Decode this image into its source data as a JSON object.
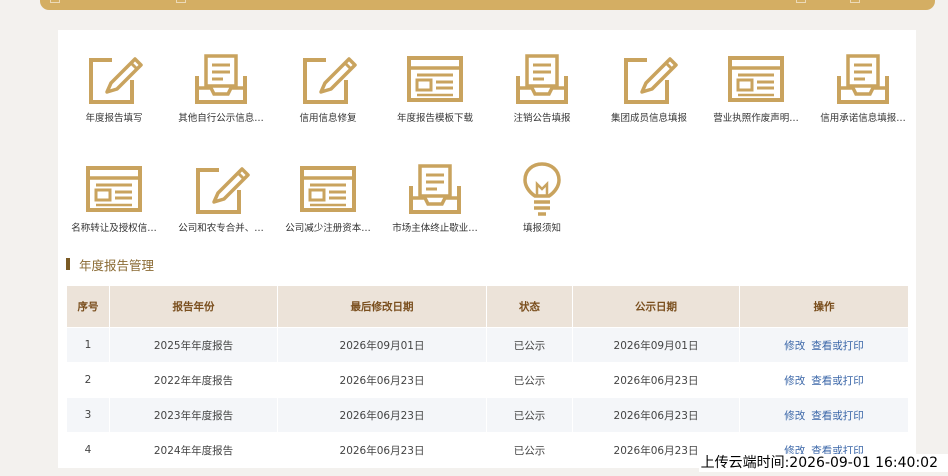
{
  "colors": {
    "accent": "#d4ae63",
    "icon_stroke": "#c9a35e",
    "header_bg": "#ece3d9",
    "link": "#3a66a8"
  },
  "shortcuts": [
    {
      "label": "年度报告填写",
      "icon": "pencil-icon"
    },
    {
      "label": "其他自行公示信息…",
      "icon": "inbox-tray-icon"
    },
    {
      "label": "信用信息修复",
      "icon": "pencil-icon"
    },
    {
      "label": "年度报告模板下载",
      "icon": "template-icon"
    },
    {
      "label": "注销公告填报",
      "icon": "inbox-tray-icon"
    },
    {
      "label": "集团成员信息填报",
      "icon": "pencil-icon"
    },
    {
      "label": "营业执照作废声明…",
      "icon": "template-icon"
    },
    {
      "label": "信用承诺信息填报…",
      "icon": "inbox-tray-icon"
    },
    {
      "label": "名称转让及授权信…",
      "icon": "template-icon"
    },
    {
      "label": "公司和农专合并、…",
      "icon": "pencil-icon"
    },
    {
      "label": "公司减少注册资本…",
      "icon": "template-icon"
    },
    {
      "label": "市场主体终止歇业…",
      "icon": "inbox-tray-icon"
    },
    {
      "label": "填报须知",
      "icon": "lightbulb-icon"
    }
  ],
  "section": {
    "title": "年度报告管理"
  },
  "table": {
    "headers": [
      "序号",
      "报告年份",
      "最后修改日期",
      "状态",
      "公示日期",
      "操作"
    ],
    "rows": [
      {
        "no": "1",
        "year": "2025年年度报告",
        "modified": "2026年09月01日",
        "status": "已公示",
        "published": "2026年09月01日",
        "edit": "修改",
        "view": "查看或打印"
      },
      {
        "no": "2",
        "year": "2022年年度报告",
        "modified": "2026年06月23日",
        "status": "已公示",
        "published": "2026年06月23日",
        "edit": "修改",
        "view": "查看或打印"
      },
      {
        "no": "3",
        "year": "2023年年度报告",
        "modified": "2026年06月23日",
        "status": "已公示",
        "published": "2026年06月23日",
        "edit": "修改",
        "view": "查看或打印"
      },
      {
        "no": "4",
        "year": "2024年年度报告",
        "modified": "2026年06月23日",
        "status": "已公示",
        "published": "2026年06月23日",
        "edit": "修改",
        "view": "查看或打印"
      }
    ]
  },
  "upload_time": "上传云端时间:2026-09-01 16:40:02"
}
